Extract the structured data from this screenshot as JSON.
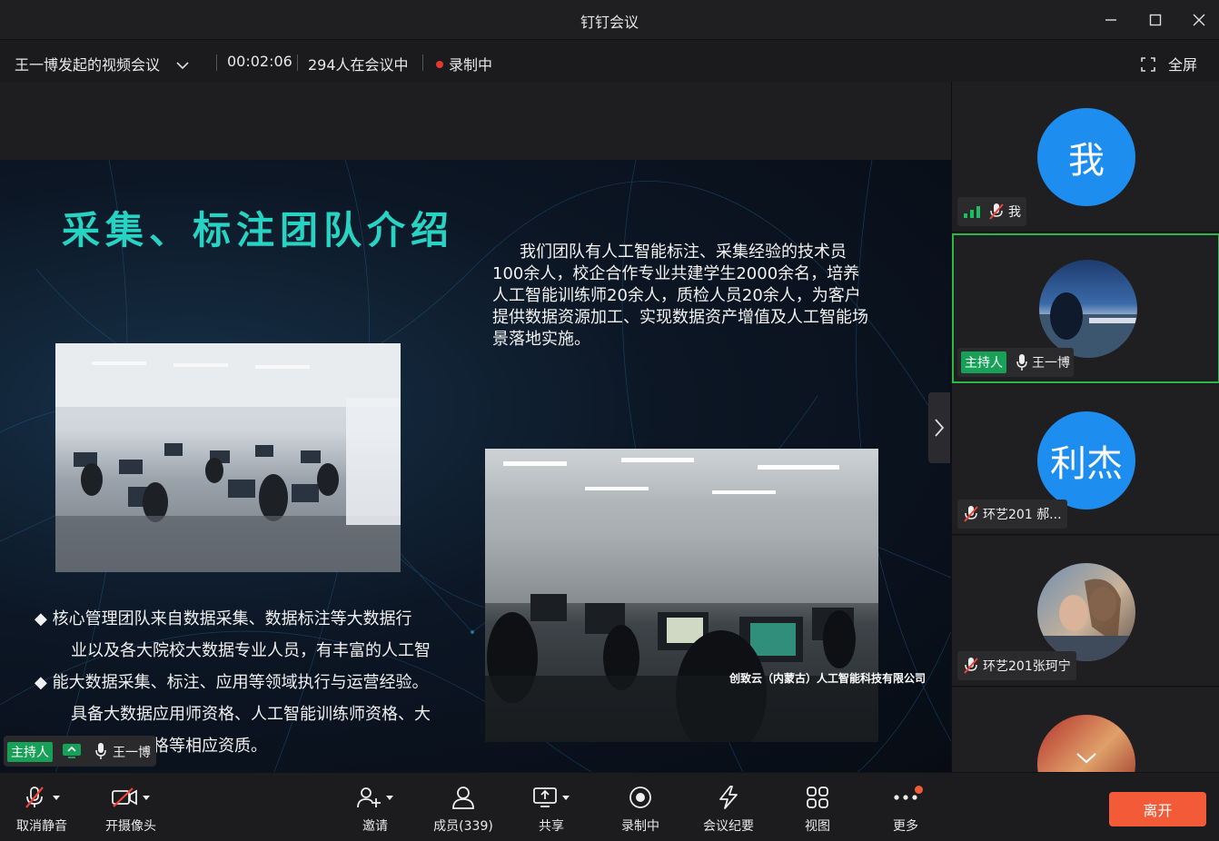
{
  "window": {
    "title": "钉钉会议"
  },
  "info": {
    "meeting_name": "王一博发起的视频会议",
    "duration": "00:02:06",
    "participants_in_meeting": "294人在会议中",
    "recording": "录制中",
    "fullscreen_label": "全屏"
  },
  "slide": {
    "title": "采集、标注团队介绍",
    "intro": "我们团队有人工智能标注、采集经验的技术员100余人，校企合作专业共建学生2000余名，培养人工智能训练师20余人，质检人员20余人，为客户提供数据资源加工、实现数据资产增值及人工智能场景落地实施。",
    "bullet1_line1": "◆ 核心管理团队来自数据采集、数据标注等大数据行",
    "bullet1_line2": "业以及各大院校大数据专业人员，有丰富的人工智",
    "bullet2_line1": "◆ 能大数据采集、标注、应用等领域执行与运营经验。",
    "bullet2_line2": "具备大数据应用师资格、人工智能训练师资格、大",
    "bullet2_line3": "数据质检资格等相应资质。",
    "company": "创致云（内蒙古）人工智能科技有限公司"
  },
  "speaker": {
    "host_tag": "主持人",
    "name": "王一博"
  },
  "participants": [
    {
      "avatar_text": "我",
      "name": "我",
      "avatar_color": "#1e8df0"
    },
    {
      "host_tag": "主持人",
      "name": "王一博"
    },
    {
      "avatar_text": "利杰",
      "name": "环艺201  郝...",
      "avatar_color": "#1e8df0"
    },
    {
      "name": "环艺201张珂宁"
    }
  ],
  "toolbar": {
    "mute": "取消静音",
    "camera": "开摄像头",
    "invite": "邀请",
    "members": "成员(339)",
    "share": "共享",
    "record": "录制中",
    "minutes": "会议纪要",
    "view": "视图",
    "more": "更多",
    "leave": "离开"
  },
  "colors": {
    "accent": "#18a058",
    "leave": "#f35b38",
    "avatar": "#1e8df0",
    "title_teal": "#27d3c3"
  }
}
